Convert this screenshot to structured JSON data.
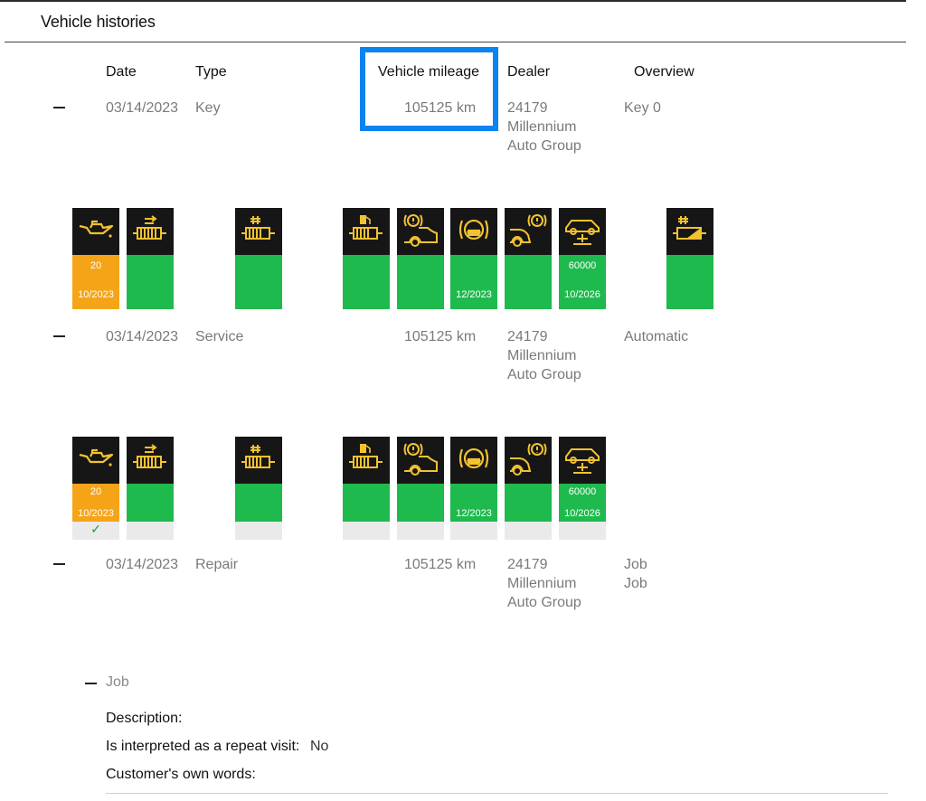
{
  "page": {
    "title": "Vehicle histories"
  },
  "columns": {
    "date": "Date",
    "type": "Type",
    "mileage": "Vehicle mileage",
    "dealer": "Dealer",
    "overview": "Overview"
  },
  "entries": [
    {
      "date": "03/14/2023",
      "type": "Key",
      "mileage": "105125 km",
      "dealer": [
        "24179",
        "Millennium",
        "Auto Group"
      ],
      "overview": [
        "Key 0"
      ]
    },
    {
      "date": "03/14/2023",
      "type": "Service",
      "mileage": "105125 km",
      "dealer": [
        "24179",
        "Millennium",
        "Auto Group"
      ],
      "overview": [
        "Automatic"
      ]
    },
    {
      "date": "03/14/2023",
      "type": "Repair",
      "mileage": "105125 km",
      "dealer": [
        "24179",
        "Millennium",
        "Auto Group"
      ],
      "overview": [
        "Job",
        "Job"
      ]
    }
  ],
  "service_sets": [
    {
      "tiles": [
        {
          "icon": "engine-oil-icon",
          "status": "orange",
          "value1": "20",
          "value2": "10/2023"
        },
        {
          "icon": "diesel-filter-icon",
          "status": "green",
          "value1": "",
          "value2": ""
        },
        {
          "icon": "fuel-filter-icon",
          "status": "green",
          "value1": "",
          "value2": ""
        },
        {
          "icon": "fuel-pump-filter-icon",
          "status": "green",
          "value1": "",
          "value2": ""
        },
        {
          "icon": "front-brake-icon",
          "status": "green",
          "value1": "",
          "value2": ""
        },
        {
          "icon": "brake-fluid-icon",
          "status": "green",
          "value1": "",
          "value2": "12/2023"
        },
        {
          "icon": "rear-brake-icon",
          "status": "green",
          "value1": "",
          "value2": ""
        },
        {
          "icon": "vehicle-inspection-icon",
          "status": "green",
          "value1": "60000",
          "value2": "10/2026"
        },
        {
          "icon": "battery-filter-icon",
          "status": "green",
          "value1": "",
          "value2": ""
        }
      ]
    },
    {
      "tiles": [
        {
          "icon": "engine-oil-icon",
          "status": "orange",
          "value1": "20",
          "value2": "10/2023",
          "check": "✓"
        },
        {
          "icon": "diesel-filter-icon",
          "status": "green",
          "value1": "",
          "value2": "",
          "check": ""
        },
        {
          "icon": "fuel-filter-icon",
          "status": "green",
          "value1": "",
          "value2": "",
          "check": ""
        },
        {
          "icon": "fuel-pump-filter-icon",
          "status": "green",
          "value1": "",
          "value2": "",
          "check": ""
        },
        {
          "icon": "front-brake-icon",
          "status": "green",
          "value1": "",
          "value2": "",
          "check": ""
        },
        {
          "icon": "brake-fluid-icon",
          "status": "green",
          "value1": "",
          "value2": "12/2023",
          "check": ""
        },
        {
          "icon": "rear-brake-icon",
          "status": "green",
          "value1": "",
          "value2": "",
          "check": ""
        },
        {
          "icon": "vehicle-inspection-icon",
          "status": "green",
          "value1": "60000",
          "value2": "10/2026",
          "check": ""
        }
      ]
    }
  ],
  "job": {
    "label": "Job",
    "description_label": "Description:",
    "repeat_visit_label": "Is interpreted as a repeat visit:",
    "repeat_visit_value": "No",
    "customer_words_label": "Customer's own words:"
  },
  "colors": {
    "highlight": "#0a84f0",
    "status_green": "#1fba4e",
    "status_orange": "#f5a418",
    "icon_yellow": "#f2c230"
  }
}
